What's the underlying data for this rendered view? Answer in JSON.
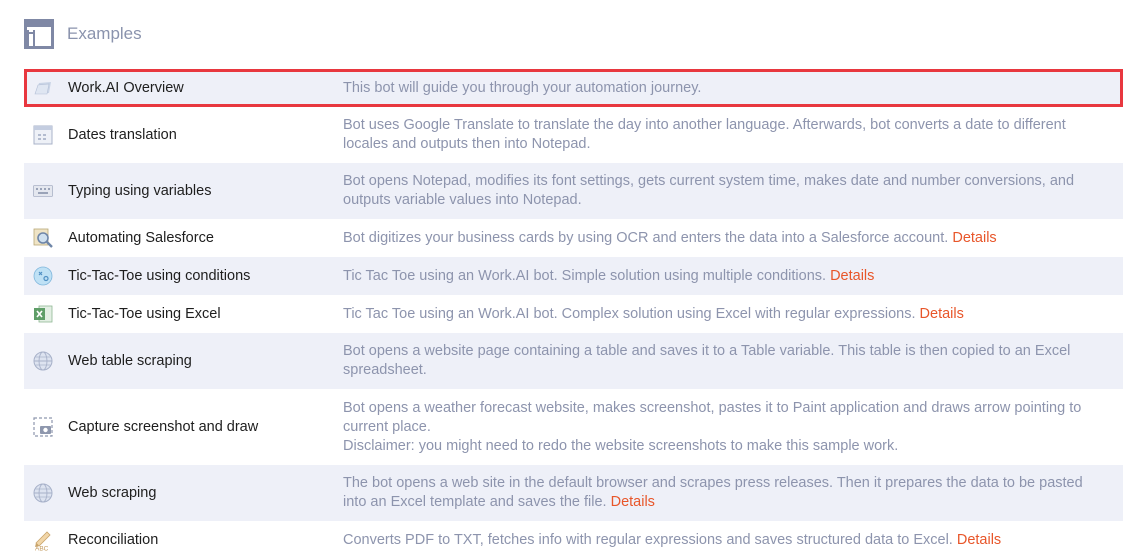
{
  "header": {
    "title": "Examples",
    "icon": "window-layout-icon"
  },
  "colors": {
    "accent_link": "#e8562a",
    "selection_border": "#e8373f",
    "row_alt": "#eef0f8",
    "desc_text": "#8d94ad"
  },
  "rows": [
    {
      "name": "Work.AI Overview",
      "icon": "document-icon",
      "lines": [
        "This bot will guide you through your automation journey."
      ],
      "details": ""
    },
    {
      "name": "Dates translation",
      "icon": "calendar-icon",
      "lines": [
        "Bot uses Google Translate to translate the day into another language. Afterwards, bot converts a date to different",
        "locales and outputs then into Notepad."
      ],
      "details": ""
    },
    {
      "name": "Typing using variables",
      "icon": "keyboard-icon",
      "lines": [
        "Bot opens Notepad, modifies its font settings, gets current system time, makes date and number conversions, and",
        "outputs variable values into Notepad."
      ],
      "details": ""
    },
    {
      "name": "Automating Salesforce",
      "icon": "ocr-scan-icon",
      "lines": [
        "Bot digitizes your business cards by using OCR and enters the data into a Salesforce account."
      ],
      "details": "Details"
    },
    {
      "name": "Tic-Tac-Toe using conditions",
      "icon": "tic-tac-toe-icon",
      "lines": [
        "Tic Tac Toe using an Work.AI bot. Simple solution using multiple conditions."
      ],
      "details": "Details"
    },
    {
      "name": "Tic-Tac-Toe using Excel",
      "icon": "excel-icon",
      "lines": [
        "Tic Tac Toe using an Work.AI bot. Complex solution using Excel with regular expressions."
      ],
      "details": "Details"
    },
    {
      "name": "Web table scraping",
      "icon": "globe-icon",
      "lines": [
        "Bot opens a website page containing a table and saves it to a Table variable. This table is then copied to an Excel",
        "spreadsheet."
      ],
      "details": ""
    },
    {
      "name": "Capture screenshot and draw",
      "icon": "camera-capture-icon",
      "lines": [
        "Bot opens a weather forecast website, makes screenshot, pastes it to Paint application and draws arrow pointing to",
        "current place.",
        "Disclaimer: you might need to redo the website screenshots to make this sample work."
      ],
      "details": ""
    },
    {
      "name": "Web scraping",
      "icon": "globe-icon",
      "lines": [
        "The bot opens a web site in the default browser and scrapes press releases. Then it prepares the data to be pasted",
        "into an Excel template and saves the file."
      ],
      "details": "Details"
    },
    {
      "name": "Reconciliation",
      "icon": "abc-pencil-icon",
      "lines": [
        "Converts PDF to TXT, fetches info with regular expressions and saves structured data to Excel."
      ],
      "details": "Details"
    }
  ]
}
